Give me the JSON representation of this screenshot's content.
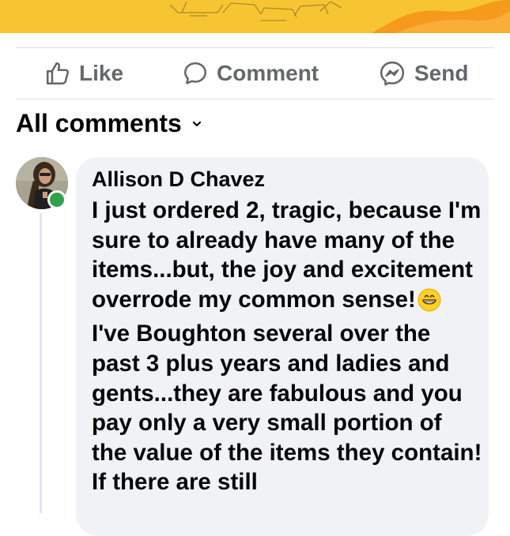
{
  "actions": {
    "like_label": "Like",
    "comment_label": "Comment",
    "send_label": "Send"
  },
  "comments_section": {
    "filter_label": "All comments"
  },
  "comment": {
    "author": "Allison D Chavez",
    "paragraph1": "I just ordered 2, tragic, because I'm sure to already have many of the items...but, the joy and excitement overrode my common sense!",
    "emoji": "grinning-face",
    "paragraph2": "I've Boughton several over the past 3 plus years and ladies and gents...they are fabulous and you pay only a very small portion of the value of the items they contain! If there are still"
  },
  "colors": {
    "banner": "#f7c531",
    "banner_accent": "#f59a1c",
    "bubble": "#f0f2f5",
    "action_text": "#65676b",
    "presence": "#31a24c"
  },
  "icons": [
    "thumbs-up-icon",
    "comment-icon",
    "messenger-icon",
    "chevron-down-icon",
    "grinning-face-emoji"
  ]
}
